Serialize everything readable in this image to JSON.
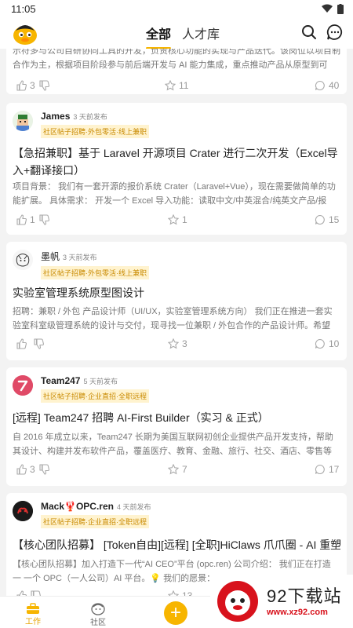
{
  "status_bar": {
    "time": "11:05"
  },
  "header": {
    "tabs": [
      "全部",
      "人才库"
    ]
  },
  "cards": [
    {
      "author": "",
      "time": "",
      "tags": "",
      "title": "",
      "body": "示符多与公司目研协同工具的开发，负责核心功能的实现与产品迭代。该岗位以项目制合作为主，根据项目阶段参与前后端开发与 AI 能力集成，重点推动产品从原型到可用…",
      "likes": "3",
      "stars": "11",
      "comments": "40"
    },
    {
      "author": "James",
      "time": "3 天前发布",
      "tags": "社区帖子招聘·外包零活·线上兼职",
      "title": "【急招兼职】基于 Laravel 开源项目 Crater 进行二次开发（Excel导入+翻译接口）",
      "body": "项目背景：  我们有一套开源的报价系统 Crater（Laravel+Vue），现在需要做简单的功能扩展。 具体需求：  开发一个 Excel 导入功能：读取中文/中英混合/纯英文产品/报价…",
      "likes": "1",
      "stars": "1",
      "comments": "15"
    },
    {
      "author": "墨帆",
      "time": "3 天前发布",
      "tags": "社区帖子招聘·外包零活·线上兼职",
      "title": "实验室管理系统原型图设计",
      "body": "招聘：兼职 / 外包 产品设计师（UI/UX，实验室管理系统方向） 我们正在推进一套实验室科室级管理系统的设计与交付，现寻找一位兼职 / 外包合作的产品设计师。希望你…",
      "likes": "",
      "stars": "3",
      "comments": "10"
    },
    {
      "author": "Team247",
      "time": "5 天前发布",
      "tags": "社区帖子招聘·企业直招·全职远程",
      "title": "[远程] Team247 招聘 AI-First Builder（实习 & 正式）",
      "body": "自 2016 年成立以来，Team247 长期为美国互联网初创企业提供产品开发支持，帮助其设计、构建并发布软件产品，覆盖医疗、教育、金融、旅行、社交、酒店、零售等多…",
      "likes": "3",
      "stars": "7",
      "comments": "17"
    },
    {
      "author": "Mack🦞OPC.ren",
      "time": "4 天前发布",
      "tags": "社区帖子招聘·企业直招·全职远程",
      "title": "【核心团队招募】 [Token自由][远程] [全职]HiClaws 爪爪圈 - AI 重塑",
      "body": "【核心团队招募】加入打造下一代“AI CEO”平台 (opc.ren) 公司介绍： 我们正在打造 一 一个 OPC（一人公司）AI 平台。💡 我们的愿景：",
      "likes": "",
      "stars": "13",
      "comments": ""
    }
  ],
  "bottom_nav": {
    "work": "工作",
    "community": "社区"
  },
  "watermark": {
    "brand": "92下载站",
    "url": "www.xz92.com"
  },
  "colors": {
    "accent": "#f7b500",
    "tag_text": "#c98a00",
    "tag_bg": "#fff3cf"
  }
}
